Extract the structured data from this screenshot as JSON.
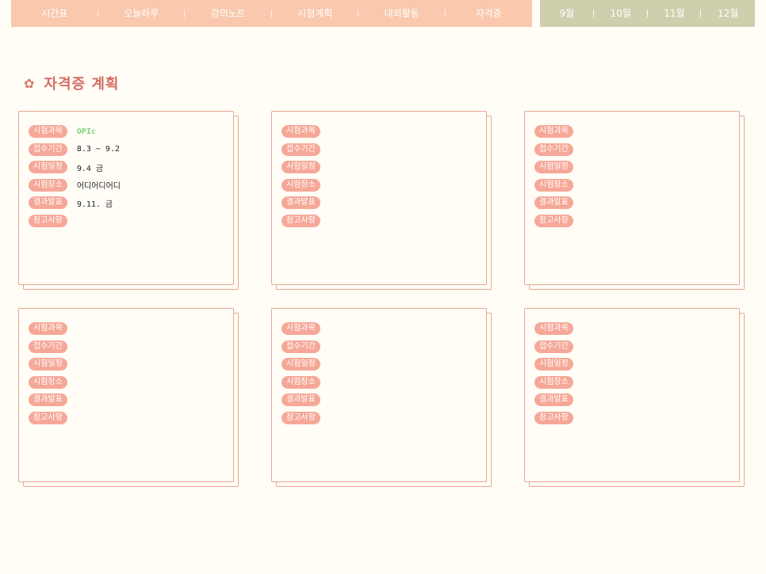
{
  "nav": {
    "tabs": [
      "시간표",
      "오늘하루",
      "강의노트",
      "시험계획",
      "대외활동",
      "자격증"
    ],
    "months": [
      "9월",
      "10월",
      "11월",
      "12월"
    ]
  },
  "page": {
    "title_icon": "flower-icon",
    "title": "자격증 계획"
  },
  "field_labels": [
    "시험과목",
    "접수기간",
    "시험일정",
    "시험장소",
    "결과발표",
    "참고사항"
  ],
  "cards": [
    {
      "subject": "OPIc",
      "period": "8.3 ~ 9.2",
      "date": "9.4 금",
      "place": "어디어디어디",
      "result": "9.11. 금",
      "note": ""
    },
    {
      "subject": "",
      "period": "",
      "date": "",
      "place": "",
      "result": "",
      "note": ""
    },
    {
      "subject": "",
      "period": "",
      "date": "",
      "place": "",
      "result": "",
      "note": ""
    },
    {
      "subject": "",
      "period": "",
      "date": "",
      "place": "",
      "result": "",
      "note": ""
    },
    {
      "subject": "",
      "period": "",
      "date": "",
      "place": "",
      "result": "",
      "note": ""
    },
    {
      "subject": "",
      "period": "",
      "date": "",
      "place": "",
      "result": "",
      "note": ""
    }
  ],
  "colors": {
    "nav_bg": "#f9c8ad",
    "month_bg": "#cfcfae",
    "pill": "#f6a898",
    "title": "#d26e64",
    "subject_value": "#7fd07f"
  }
}
